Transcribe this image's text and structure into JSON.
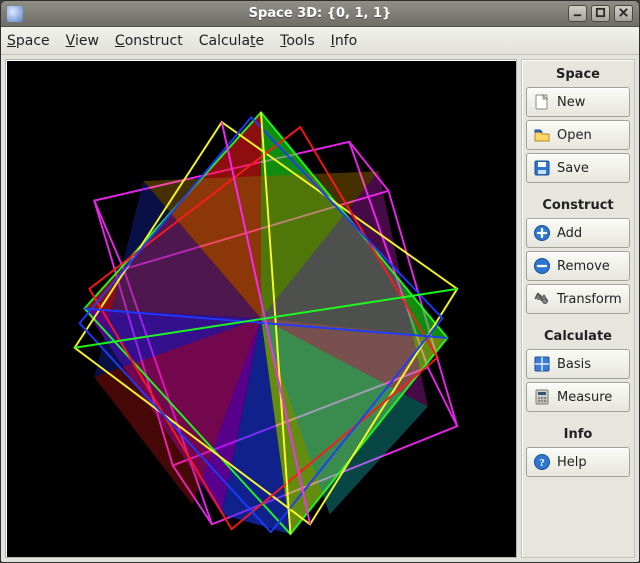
{
  "window": {
    "title": "Space 3D: {0, 1, 1}",
    "minimize_aria": "Minimize",
    "maximize_aria": "Maximize",
    "close_aria": "Close"
  },
  "menubar": {
    "items": [
      {
        "label": "Space",
        "accel_index": 0
      },
      {
        "label": "View",
        "accel_index": 0
      },
      {
        "label": "Construct",
        "accel_index": 0
      },
      {
        "label": "Calculate",
        "accel_index": 7
      },
      {
        "label": "Tools",
        "accel_index": 0
      },
      {
        "label": "Info",
        "accel_index": 0
      }
    ]
  },
  "sidebar": {
    "sections": [
      {
        "title": "Space",
        "items": [
          {
            "icon": "file-new-icon",
            "label": "New"
          },
          {
            "icon": "folder-open-icon",
            "label": "Open"
          },
          {
            "icon": "save-icon",
            "label": "Save"
          }
        ]
      },
      {
        "title": "Construct",
        "items": [
          {
            "icon": "add-icon",
            "label": "Add"
          },
          {
            "icon": "remove-icon",
            "label": "Remove"
          },
          {
            "icon": "transform-icon",
            "label": "Transform"
          }
        ]
      },
      {
        "title": "Calculate",
        "items": [
          {
            "icon": "basis-icon",
            "label": "Basis"
          },
          {
            "icon": "measure-icon",
            "label": "Measure"
          }
        ]
      },
      {
        "title": "Info",
        "items": [
          {
            "icon": "help-icon",
            "label": "Help"
          }
        ]
      }
    ]
  },
  "viewport": {
    "description": "3D rendering of a compound of octahedra inside a cube, translucent colored faces on black background",
    "colors": {
      "background": "#000000",
      "red": "#ff1a1a",
      "green": "#1eff1e",
      "blue": "#1e3cff",
      "yellow": "#ffff28",
      "magenta": "#ff28ff",
      "cyan": "#1effff"
    }
  }
}
